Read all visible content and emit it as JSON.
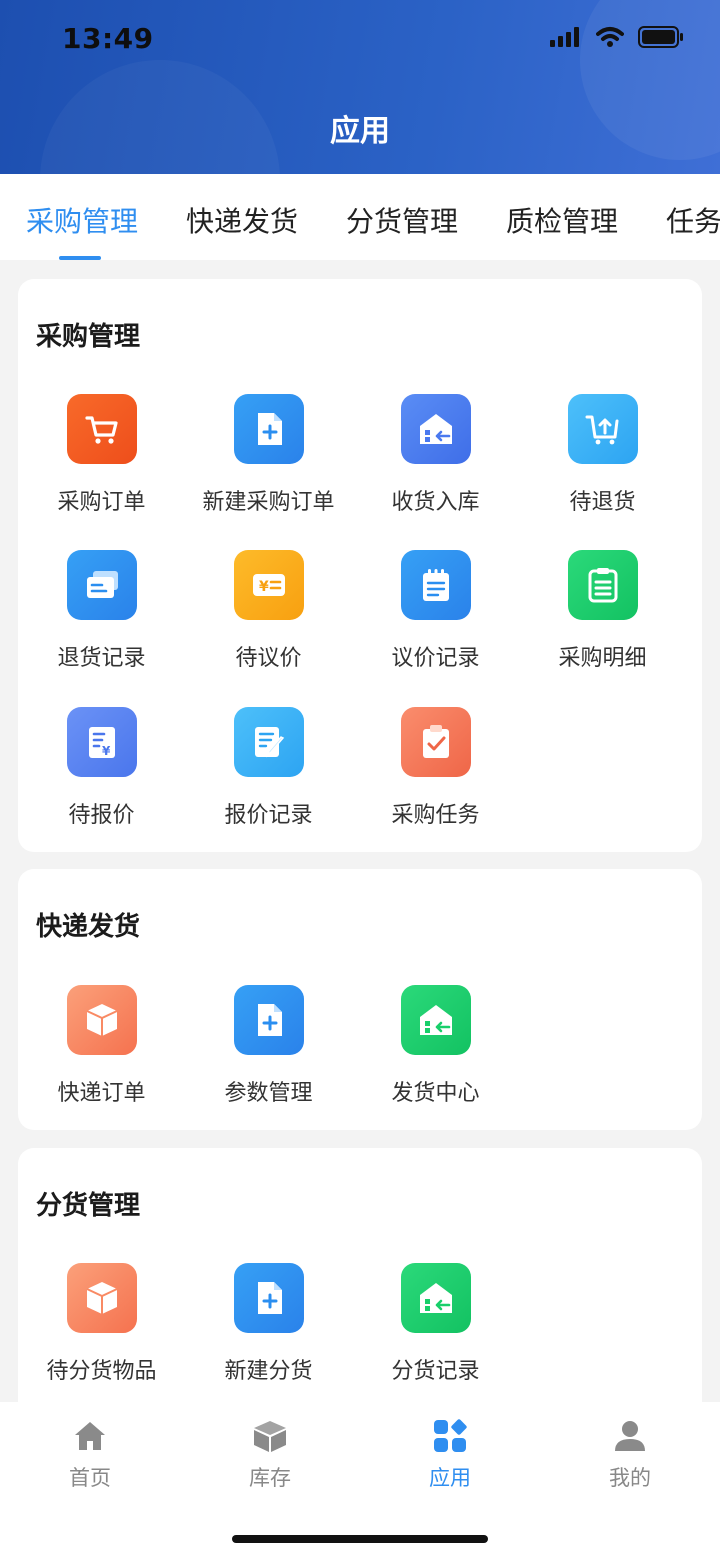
{
  "status_bar": {
    "time": "13:49"
  },
  "header": {
    "title": "应用"
  },
  "tabs": [
    {
      "label": "采购管理",
      "active": true
    },
    {
      "label": "快递发货",
      "active": false
    },
    {
      "label": "分货管理",
      "active": false
    },
    {
      "label": "质检管理",
      "active": false
    },
    {
      "label": "任务",
      "active": false
    }
  ],
  "sections": [
    {
      "title": "采购管理",
      "items": [
        {
          "label": "采购订单",
          "icon": "cart-icon",
          "color": "#f25a22"
        },
        {
          "label": "新建采购订单",
          "icon": "new-document-icon",
          "color": "#2a8ef0"
        },
        {
          "label": "收货入库",
          "icon": "warehouse-in-icon",
          "color": "#4a79ef"
        },
        {
          "label": "待退货",
          "icon": "cart-return-icon",
          "color": "#3cb1f7"
        },
        {
          "label": "退货记录",
          "icon": "cards-icon",
          "color": "#2a8ef0"
        },
        {
          "label": "待议价",
          "icon": "price-tag-icon",
          "color": "#fbac14"
        },
        {
          "label": "议价记录",
          "icon": "notepad-icon",
          "color": "#2a8ef0"
        },
        {
          "label": "采购明细",
          "icon": "clipboard-list-icon",
          "color": "#1fcf6c"
        },
        {
          "label": "待报价",
          "icon": "quote-document-icon",
          "color": "#5b82f2"
        },
        {
          "label": "报价记录",
          "icon": "edit-document-icon",
          "color": "#3cb1f7"
        },
        {
          "label": "采购任务",
          "icon": "task-clipboard-icon",
          "color": "#f4775a"
        }
      ]
    },
    {
      "title": "快递发货",
      "items": [
        {
          "label": "快递订单",
          "icon": "box-icon",
          "color": "#f98a64"
        },
        {
          "label": "参数管理",
          "icon": "new-document-icon",
          "color": "#2a8ef0"
        },
        {
          "label": "发货中心",
          "icon": "warehouse-out-icon",
          "color": "#18cf6a"
        }
      ]
    },
    {
      "title": "分货管理",
      "items": [
        {
          "label": "待分货物品",
          "icon": "box-icon",
          "color": "#f98a64"
        },
        {
          "label": "新建分货",
          "icon": "new-document-icon",
          "color": "#2a8ef0"
        },
        {
          "label": "分货记录",
          "icon": "warehouse-out-icon",
          "color": "#18cf6a"
        }
      ]
    }
  ],
  "bottom_nav": [
    {
      "label": "首页",
      "icon": "home-icon",
      "active": false
    },
    {
      "label": "库存",
      "icon": "inventory-box-icon",
      "active": false
    },
    {
      "label": "应用",
      "icon": "apps-icon",
      "active": true
    },
    {
      "label": "我的",
      "icon": "user-icon",
      "active": false
    }
  ],
  "colors": {
    "primary": "#2f8ef0",
    "header": "#2559bd"
  }
}
